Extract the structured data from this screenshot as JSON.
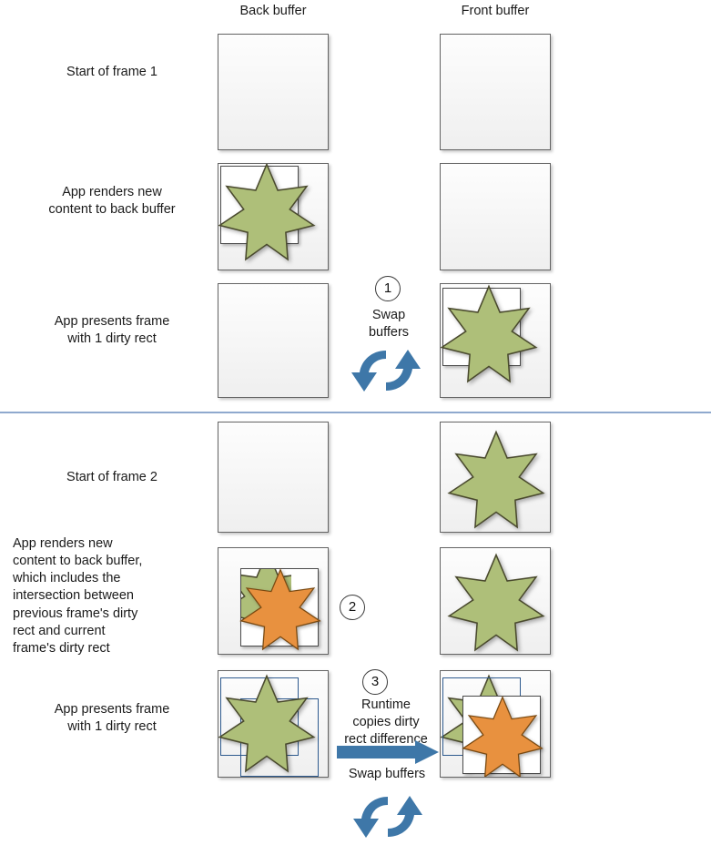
{
  "diagram": {
    "title": "Flip model swap chain with dirty rects",
    "columns": [
      {
        "label": "Back buffer"
      },
      {
        "label": "Front buffer"
      }
    ],
    "colors": {
      "star_green": "#AEBF79",
      "star_green_stroke": "#4a4a2e",
      "star_orange": "#E8913F",
      "star_orange_stroke": "#7a4a12",
      "swap_blue": "#3E77A8",
      "arrow_blue": "#3E77A8",
      "dirty_rect_outline": "#2E5A8E",
      "buffer_border": "#646464",
      "divider": "#8FA9CE",
      "text": "#1a1a1a"
    },
    "frame1": {
      "rows": [
        {
          "label": "Start of frame 1"
        },
        {
          "label": "App renders new\ncontent to back buffer"
        },
        {
          "label": "App presents frame\nwith 1 dirty rect"
        }
      ]
    },
    "frame2": {
      "rows": [
        {
          "label": "Start of frame 2"
        },
        {
          "label": "App renders new\ncontent to back buffer,\nwhich includes the\nintersection between\nprevious frame's dirty\nrect and current\nframe's dirty rect"
        },
        {
          "label": "App presents frame\nwith 1 dirty rect"
        }
      ]
    },
    "steps": [
      {
        "number": "1",
        "caption": "Swap\nbuffers",
        "icon": "swap-buffers-icon"
      },
      {
        "number": "2",
        "caption": "",
        "icon": ""
      },
      {
        "number": "3",
        "caption": "Runtime\ncopies dirty\nrect difference",
        "caption2": "Swap buffers",
        "icon": "copy-arrow-icon",
        "icon2": "swap-buffers-icon"
      }
    ]
  }
}
